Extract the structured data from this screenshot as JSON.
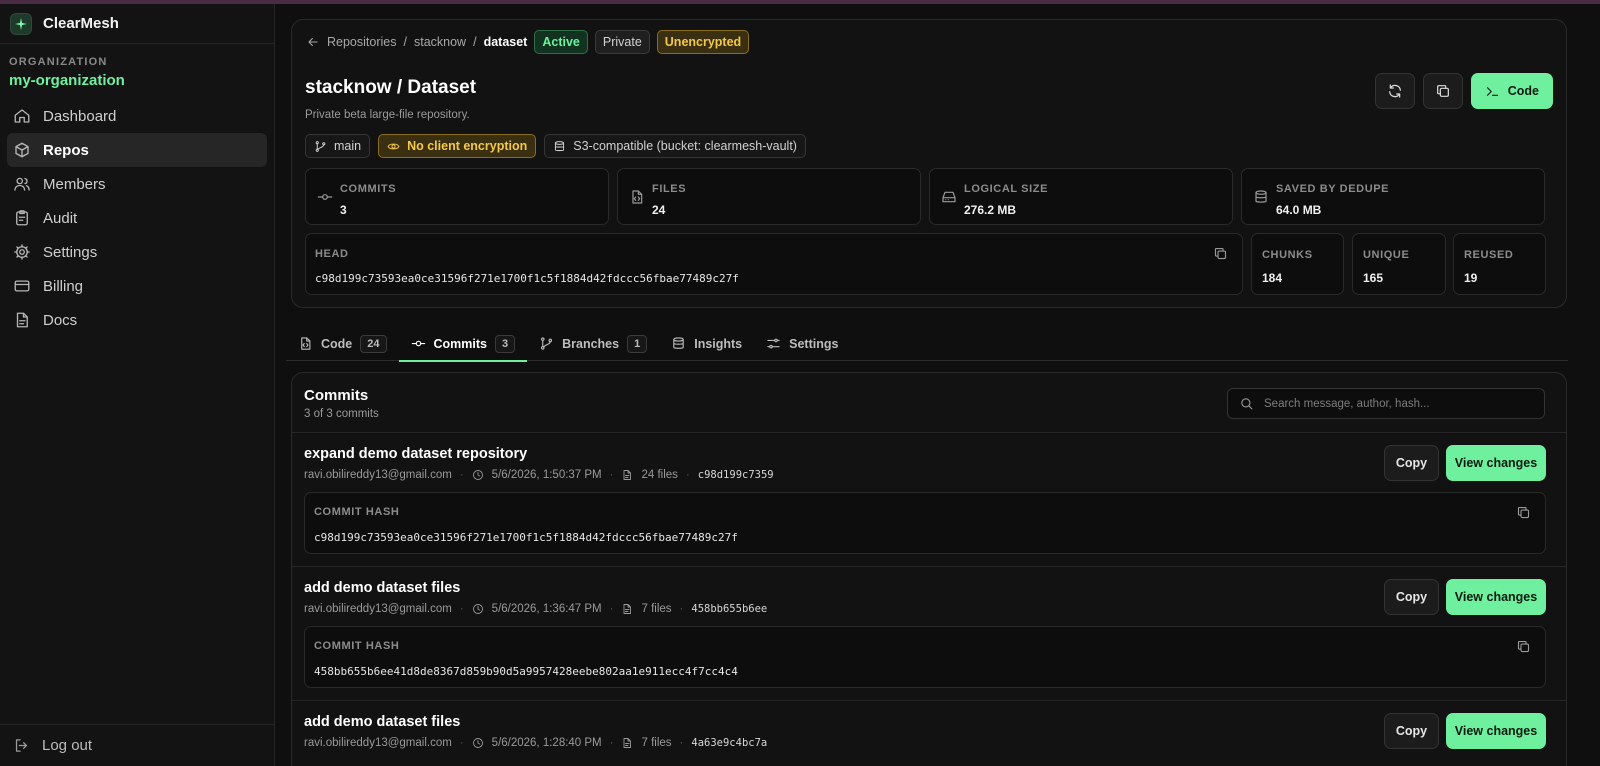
{
  "app": {
    "name": "ClearMesh"
  },
  "sidebar": {
    "org_label": "ORGANIZATION",
    "org_name": "my-organization",
    "items": [
      {
        "label": "Dashboard",
        "icon": "home-icon"
      },
      {
        "label": "Repos",
        "icon": "box-icon",
        "active": true
      },
      {
        "label": "Members",
        "icon": "users-icon"
      },
      {
        "label": "Audit",
        "icon": "clipboard-icon"
      },
      {
        "label": "Settings",
        "icon": "gear-icon"
      },
      {
        "label": "Billing",
        "icon": "card-icon"
      },
      {
        "label": "Docs",
        "icon": "document-icon"
      }
    ],
    "logout_label": "Log out"
  },
  "breadcrumb": {
    "root": "Repositories",
    "sep": "/",
    "owner": "stacknow",
    "repo": "dataset",
    "badges": {
      "status": "Active",
      "visibility": "Private",
      "encryption": "Unencrypted"
    }
  },
  "repo": {
    "title": "stacknow / Dataset",
    "description": "Private beta large-file repository.",
    "code_button": "Code",
    "chips": {
      "branch": "main",
      "encryption": "No client encryption",
      "storage": "S3-compatible (bucket: clearmesh-vault)"
    },
    "stats": [
      {
        "label": "COMMITS",
        "value": "3",
        "icon": "commit-icon"
      },
      {
        "label": "FILES",
        "value": "24",
        "icon": "file-code-icon"
      },
      {
        "label": "LOGICAL SIZE",
        "value": "276.2 MB",
        "icon": "drive-icon"
      },
      {
        "label": "SAVED BY DEDUPE",
        "value": "64.0 MB",
        "icon": "database-icon"
      }
    ],
    "head": {
      "label": "HEAD",
      "hash": "c98d199c73593ea0ce31596f271e1700f1c5f1884d42fdccc56fbae77489c27f"
    },
    "mini_stats": [
      {
        "label": "CHUNKS",
        "value": "184"
      },
      {
        "label": "UNIQUE",
        "value": "165"
      },
      {
        "label": "REUSED",
        "value": "19"
      }
    ]
  },
  "tabs": [
    {
      "label": "Code",
      "count": "24",
      "icon": "file-code-icon"
    },
    {
      "label": "Commits",
      "count": "3",
      "icon": "commit-icon",
      "active": true
    },
    {
      "label": "Branches",
      "count": "1",
      "icon": "branch-icon"
    },
    {
      "label": "Insights",
      "count": null,
      "icon": "database-icon"
    },
    {
      "label": "Settings",
      "count": null,
      "icon": "sliders-icon"
    }
  ],
  "commits": {
    "title": "Commits",
    "subtitle": "3 of 3 commits",
    "search_placeholder": "Search message, author, hash...",
    "hash_label": "COMMIT HASH",
    "copy_label": "Copy",
    "view_label": "View changes",
    "items": [
      {
        "message": "expand demo dataset repository",
        "author": "ravi.obilireddy13@gmail.com",
        "date": "5/6/2026, 1:50:37 PM",
        "files": "24 files",
        "short_hash": "c98d199c7359",
        "hash": "c98d199c73593ea0ce31596f271e1700f1c5f1884d42fdccc56fbae77489c27f"
      },
      {
        "message": "add demo dataset files",
        "author": "ravi.obilireddy13@gmail.com",
        "date": "5/6/2026, 1:36:47 PM",
        "files": "7 files",
        "short_hash": "458bb655b6ee",
        "hash": "458bb655b6ee41d8de8367d859b90d5a9957428eebe802aa1e911ecc4f7cc4c4"
      },
      {
        "message": "add demo dataset files",
        "author": "ravi.obilireddy13@gmail.com",
        "date": "5/6/2026, 1:28:40 PM",
        "files": "7 files",
        "short_hash": "4a63e9c4bc7a",
        "hash": ""
      }
    ]
  },
  "colors": {
    "accent": "#6ef09e",
    "warning": "#f2c94c",
    "background": "#0f0f0f"
  }
}
